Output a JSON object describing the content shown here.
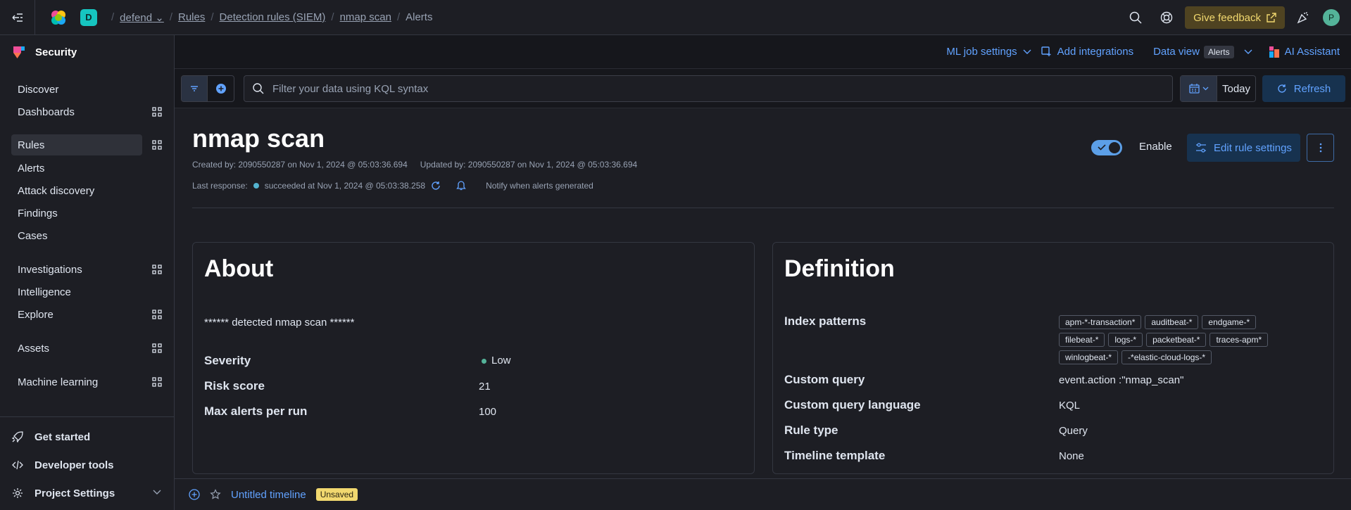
{
  "header": {
    "space_letter": "D",
    "breadcrumbs": [
      "defend",
      "Rules",
      "Detection rules (SIEM)",
      "nmap scan",
      "Alerts"
    ],
    "feedback_label": "Give feedback",
    "avatar_letter": "P"
  },
  "sidebar": {
    "title": "Security",
    "items": [
      {
        "label": "Discover"
      },
      {
        "label": "Dashboards"
      },
      {
        "label": "Rules"
      },
      {
        "label": "Alerts"
      },
      {
        "label": "Attack discovery"
      },
      {
        "label": "Findings"
      },
      {
        "label": "Cases"
      },
      {
        "label": "Investigations"
      },
      {
        "label": "Intelligence"
      },
      {
        "label": "Explore"
      },
      {
        "label": "Assets"
      },
      {
        "label": "Machine learning"
      }
    ],
    "bottom": [
      {
        "label": "Get started"
      },
      {
        "label": "Developer tools"
      },
      {
        "label": "Project Settings"
      }
    ]
  },
  "subbar": {
    "ml_settings": "ML job settings",
    "add_integrations": "Add integrations",
    "data_view_label": "Data view",
    "data_view_value": "Alerts",
    "ai_assistant": "AI Assistant"
  },
  "query": {
    "placeholder": "Filter your data using KQL syntax",
    "date_label": "Today",
    "refresh_label": "Refresh"
  },
  "rule": {
    "title": "nmap scan",
    "created": "Created by: 2090550287 on Nov 1, 2024 @ 05:03:36.694",
    "updated": "Updated by: 2090550287 on Nov 1, 2024 @ 05:03:36.694",
    "last_response_label": "Last response:",
    "last_response_value": "succeeded at Nov 1, 2024 @ 05:03:38.258",
    "notify_text": "Notify when alerts generated",
    "enable_label": "Enable",
    "enabled": true,
    "edit_label": "Edit rule settings"
  },
  "about": {
    "title": "About",
    "description": "****** detected nmap scan ******",
    "fields": [
      {
        "key": "Severity",
        "value": "Low"
      },
      {
        "key": "Risk score",
        "value": "21"
      },
      {
        "key": "Max alerts per run",
        "value": "100"
      }
    ]
  },
  "definition": {
    "title": "Definition",
    "index_patterns_label": "Index patterns",
    "index_patterns": [
      "apm-*-transaction*",
      "auditbeat-*",
      "endgame-*",
      "filebeat-*",
      "logs-*",
      "packetbeat-*",
      "traces-apm*",
      "winlogbeat-*",
      "-*elastic-cloud-logs-*"
    ],
    "fields": [
      {
        "key": "Custom query",
        "value": "event.action :\"nmap_scan\""
      },
      {
        "key": "Custom query language",
        "value": "KQL"
      },
      {
        "key": "Rule type",
        "value": "Query"
      },
      {
        "key": "Timeline template",
        "value": "None"
      }
    ]
  },
  "timeline": {
    "title": "Untitled timeline",
    "badge": "Unsaved"
  },
  "colors": {
    "accent": "#61a2ff",
    "feedback": "#f1d86f",
    "severity_low": "#54b399"
  }
}
